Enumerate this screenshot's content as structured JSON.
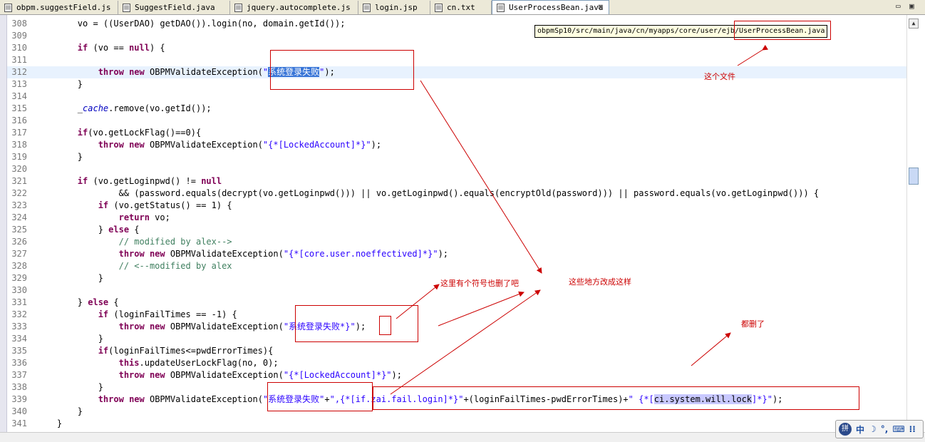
{
  "tabs": [
    {
      "label": "obpm.suggestField.js",
      "active": false
    },
    {
      "label": "SuggestField.java",
      "active": false
    },
    {
      "label": "jquery.autocomplete.js",
      "active": false
    },
    {
      "label": "login.jsp",
      "active": false
    },
    {
      "label": "cn.txt",
      "active": false
    },
    {
      "label": "UserProcessBean.java",
      "active": true,
      "close": "⊠"
    }
  ],
  "window_controls": {
    "minimize": "▭",
    "maximize": "▣"
  },
  "tooltip": {
    "path_prefix": "obpmSp10/src/main/java/cn/myapps/core/user/ejb/",
    "filename": "UserProcessBean.java"
  },
  "annotations": {
    "this_file": "这个文件",
    "symbol_deleted": "这里有个符号也删了吧",
    "change_like_this": "这些地方改成这样",
    "all_deleted": "都删了"
  },
  "code_lines": [
    {
      "n": "308",
      "segs": [
        {
          "t": "        vo = ((UserDAO) getDAO()).login(no, domain.getId());"
        }
      ]
    },
    {
      "n": "309",
      "segs": []
    },
    {
      "n": "310",
      "segs": [
        {
          "t": "        "
        },
        {
          "t": "if",
          "c": "kw"
        },
        {
          "t": " (vo == "
        },
        {
          "t": "null",
          "c": "kw"
        },
        {
          "t": ") {"
        }
      ]
    },
    {
      "n": "311",
      "segs": []
    },
    {
      "n": "312",
      "hl": true,
      "segs": [
        {
          "t": "            "
        },
        {
          "t": "throw",
          "c": "kw"
        },
        {
          "t": " "
        },
        {
          "t": "new",
          "c": "kw"
        },
        {
          "t": " OBPMValidateException("
        },
        {
          "t": "\"",
          "c": "str"
        },
        {
          "t": "系统登录失败",
          "c": "sel"
        },
        {
          "t": "\"",
          "c": "str"
        },
        {
          "t": ");"
        }
      ]
    },
    {
      "n": "313",
      "segs": [
        {
          "t": "        }"
        }
      ]
    },
    {
      "n": "314",
      "segs": []
    },
    {
      "n": "315",
      "segs": [
        {
          "t": "        _"
        },
        {
          "t": "cache",
          "c": "it"
        },
        {
          "t": ".remove(vo.getId());"
        }
      ]
    },
    {
      "n": "316",
      "segs": []
    },
    {
      "n": "317",
      "segs": [
        {
          "t": "        "
        },
        {
          "t": "if",
          "c": "kw"
        },
        {
          "t": "(vo.getLockFlag()==0){"
        }
      ]
    },
    {
      "n": "318",
      "segs": [
        {
          "t": "            "
        },
        {
          "t": "throw",
          "c": "kw"
        },
        {
          "t": " "
        },
        {
          "t": "new",
          "c": "kw"
        },
        {
          "t": " OBPMValidateException("
        },
        {
          "t": "\"{*[LockedAccount]*}\"",
          "c": "str"
        },
        {
          "t": ");"
        }
      ]
    },
    {
      "n": "319",
      "segs": [
        {
          "t": "        }"
        }
      ]
    },
    {
      "n": "320",
      "segs": []
    },
    {
      "n": "321",
      "segs": [
        {
          "t": "        "
        },
        {
          "t": "if",
          "c": "kw"
        },
        {
          "t": " (vo.getLoginpwd() != "
        },
        {
          "t": "null",
          "c": "kw"
        }
      ]
    },
    {
      "n": "322",
      "segs": [
        {
          "t": "                && (password.equals(decrypt(vo.getLoginpwd())) || vo.getLoginpwd().equals(encryptOld(password))) || password.equals(vo.getLoginpwd())) {"
        }
      ]
    },
    {
      "n": "323",
      "segs": [
        {
          "t": "            "
        },
        {
          "t": "if",
          "c": "kw"
        },
        {
          "t": " (vo.getStatus() == 1) {"
        }
      ]
    },
    {
      "n": "324",
      "segs": [
        {
          "t": "                "
        },
        {
          "t": "return",
          "c": "kw"
        },
        {
          "t": " vo;"
        }
      ]
    },
    {
      "n": "325",
      "segs": [
        {
          "t": "            } "
        },
        {
          "t": "else",
          "c": "kw"
        },
        {
          "t": " {"
        }
      ]
    },
    {
      "n": "326",
      "segs": [
        {
          "t": "                // modified by alex-->",
          "c": "cm"
        }
      ]
    },
    {
      "n": "327",
      "segs": [
        {
          "t": "                "
        },
        {
          "t": "throw",
          "c": "kw"
        },
        {
          "t": " "
        },
        {
          "t": "new",
          "c": "kw"
        },
        {
          "t": " OBPMValidateException("
        },
        {
          "t": "\"{*[core.user.noeffectived]*}\"",
          "c": "str"
        },
        {
          "t": ");"
        }
      ]
    },
    {
      "n": "328",
      "segs": [
        {
          "t": "                // <--modified by alex",
          "c": "cm"
        }
      ]
    },
    {
      "n": "329",
      "segs": [
        {
          "t": "            }"
        }
      ]
    },
    {
      "n": "330",
      "segs": []
    },
    {
      "n": "331",
      "segs": [
        {
          "t": "        } "
        },
        {
          "t": "else",
          "c": "kw"
        },
        {
          "t": " {"
        }
      ]
    },
    {
      "n": "332",
      "segs": [
        {
          "t": "            "
        },
        {
          "t": "if",
          "c": "kw"
        },
        {
          "t": " (loginFailTimes == -1) {"
        }
      ]
    },
    {
      "n": "333",
      "segs": [
        {
          "t": "                "
        },
        {
          "t": "throw",
          "c": "kw"
        },
        {
          "t": " "
        },
        {
          "t": "new",
          "c": "kw"
        },
        {
          "t": " OBPMValidateException("
        },
        {
          "t": "\"系统登录失败*}\"",
          "c": "str"
        },
        {
          "t": ");"
        }
      ]
    },
    {
      "n": "334",
      "segs": [
        {
          "t": "            }"
        }
      ]
    },
    {
      "n": "335",
      "segs": [
        {
          "t": "            "
        },
        {
          "t": "if",
          "c": "kw"
        },
        {
          "t": "(loginFailTimes<=pwdErrorTimes){"
        }
      ]
    },
    {
      "n": "336",
      "segs": [
        {
          "t": "                "
        },
        {
          "t": "this",
          "c": "kw"
        },
        {
          "t": ".updateUserLockFlag(no, 0);"
        }
      ]
    },
    {
      "n": "337",
      "segs": [
        {
          "t": "                "
        },
        {
          "t": "throw",
          "c": "kw"
        },
        {
          "t": " "
        },
        {
          "t": "new",
          "c": "kw"
        },
        {
          "t": " OBPMValidateException("
        },
        {
          "t": "\"{*[LockedAccount]*}\"",
          "c": "str"
        },
        {
          "t": ");"
        }
      ]
    },
    {
      "n": "338",
      "segs": [
        {
          "t": "            }"
        }
      ]
    },
    {
      "n": "339",
      "segs": [
        {
          "t": "            "
        },
        {
          "t": "throw",
          "c": "kw"
        },
        {
          "t": " "
        },
        {
          "t": "new",
          "c": "kw"
        },
        {
          "t": " OBPMValidateException("
        },
        {
          "t": "\"系统登录失败\"",
          "c": "str"
        },
        {
          "t": "+"
        },
        {
          "t": "\",{*[if.zai.fail.login]*}\"",
          "c": "str"
        },
        {
          "t": "+(loginFailTimes-pwdErrorTimes)+"
        },
        {
          "t": "\" {*[",
          "c": "str"
        },
        {
          "t": "ci.system.will.lock",
          "c": "ci"
        },
        {
          "t": "]*}\"",
          "c": "str"
        },
        {
          "t": ");"
        }
      ]
    },
    {
      "n": "340",
      "segs": [
        {
          "t": "        }"
        }
      ]
    },
    {
      "n": "341",
      "segs": [
        {
          "t": "    }"
        }
      ]
    }
  ],
  "ime": {
    "logo": "拼",
    "chinese": "中",
    "moon": "☽",
    "punct": "°,",
    "keyboard": "⌨",
    "extra": "⁝⁝"
  },
  "scroll": {
    "up": "▲",
    "down": "▼"
  }
}
